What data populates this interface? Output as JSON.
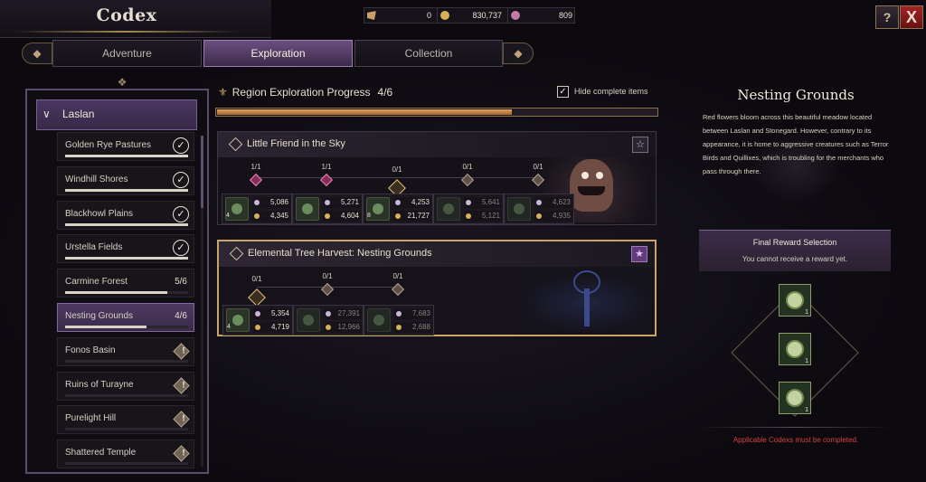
{
  "header": {
    "title": "Codex",
    "currencies": [
      {
        "icon": "quill-icon",
        "value": "0"
      },
      {
        "icon": "gold-coin-icon",
        "value": "830,737"
      },
      {
        "icon": "pink-gem-icon",
        "value": "809"
      }
    ],
    "help_icon": "help-book-icon",
    "close_label": "X"
  },
  "tabs": {
    "prev_label": "◆",
    "next_label": "◆",
    "items": [
      {
        "label": "Adventure",
        "active": false
      },
      {
        "label": "Exploration",
        "active": true
      },
      {
        "label": "Collection",
        "active": false
      }
    ]
  },
  "sidebar": {
    "region": "Laslan",
    "locations": [
      {
        "name": "Golden Rye Pastures",
        "status": "complete",
        "progress": 1.0
      },
      {
        "name": "Windhill Shores",
        "status": "complete",
        "progress": 1.0
      },
      {
        "name": "Blackhowl Plains",
        "status": "complete",
        "progress": 1.0
      },
      {
        "name": "Urstella Fields",
        "status": "complete",
        "progress": 1.0
      },
      {
        "name": "Carmine Forest",
        "status": "count",
        "count": "5/6",
        "progress": 0.83
      },
      {
        "name": "Nesting Grounds",
        "status": "count",
        "count": "4/6",
        "progress": 0.66,
        "selected": true
      },
      {
        "name": "Fonos Basin",
        "status": "locked",
        "progress": 0
      },
      {
        "name": "Ruins of Turayne",
        "status": "locked",
        "progress": 0
      },
      {
        "name": "Purelight Hill",
        "status": "locked",
        "progress": 0
      },
      {
        "name": "Shattered Temple",
        "status": "locked",
        "progress": 0
      }
    ]
  },
  "progress": {
    "title": "Region Exploration Progress",
    "value": "4/6",
    "fraction": 0.67,
    "hide_complete_label": "Hide complete items",
    "hide_complete_checked": true
  },
  "quests": [
    {
      "title": "Little Friend in the Sky",
      "starred": false,
      "nodes": [
        {
          "count": "1/1",
          "state": "done"
        },
        {
          "count": "1/1",
          "state": "done"
        },
        {
          "count": "0/1",
          "state": "current"
        },
        {
          "count": "0/1",
          "state": "locked"
        },
        {
          "count": "0/1",
          "state": "locked"
        }
      ],
      "rewards": [
        {
          "qty": "4",
          "top": "5,086",
          "bottom": "4,345",
          "dim": false
        },
        {
          "qty": "",
          "top": "5,271",
          "bottom": "4,604",
          "dim": false
        },
        {
          "qty": "8",
          "top": "4,253",
          "bottom": "21,727",
          "dim": false
        },
        {
          "qty": "",
          "top": "5,641",
          "bottom": "5,121",
          "dim": true
        },
        {
          "qty": "",
          "top": "4,623",
          "bottom": "4,935",
          "dim": true
        }
      ]
    },
    {
      "title": "Elemental Tree Harvest: Nesting Grounds",
      "starred": true,
      "nodes": [
        {
          "count": "0/1",
          "state": "current"
        },
        {
          "count": "0/1",
          "state": "locked"
        },
        {
          "count": "0/1",
          "state": "locked"
        }
      ],
      "rewards": [
        {
          "qty": "4",
          "top": "5,354",
          "bottom": "4,719",
          "dim": false
        },
        {
          "qty": "",
          "top": "27,391",
          "bottom": "12,966",
          "dim": true
        },
        {
          "qty": "",
          "top": "7,683",
          "bottom": "2,688",
          "dim": true
        }
      ]
    }
  ],
  "info": {
    "title": "Nesting Grounds",
    "description": "Red flowers bloom across this beautiful meadow located between Laslan and Stonegard. However, contrary to its appearance, it is home to aggressive creatures such as Terror Birds and Quillixes, which is troubling for the merchants who pass through there.",
    "final_reward_title": "Final Reward Selection",
    "final_reward_sub": "You cannot receive a reward yet.",
    "final_rewards": [
      {
        "icon": "sword-emblem-icon",
        "qty": "1"
      },
      {
        "icon": "armor-emblem-icon",
        "qty": "1"
      },
      {
        "icon": "ring-emblem-icon",
        "qty": "1"
      }
    ],
    "warning": "Applicable Codexs must be completed.",
    "warning_color": "#d94040"
  },
  "colors": {
    "accent_purple": "#4e3960",
    "gold": "#caa56a",
    "progress_orange": "#d08a45"
  }
}
